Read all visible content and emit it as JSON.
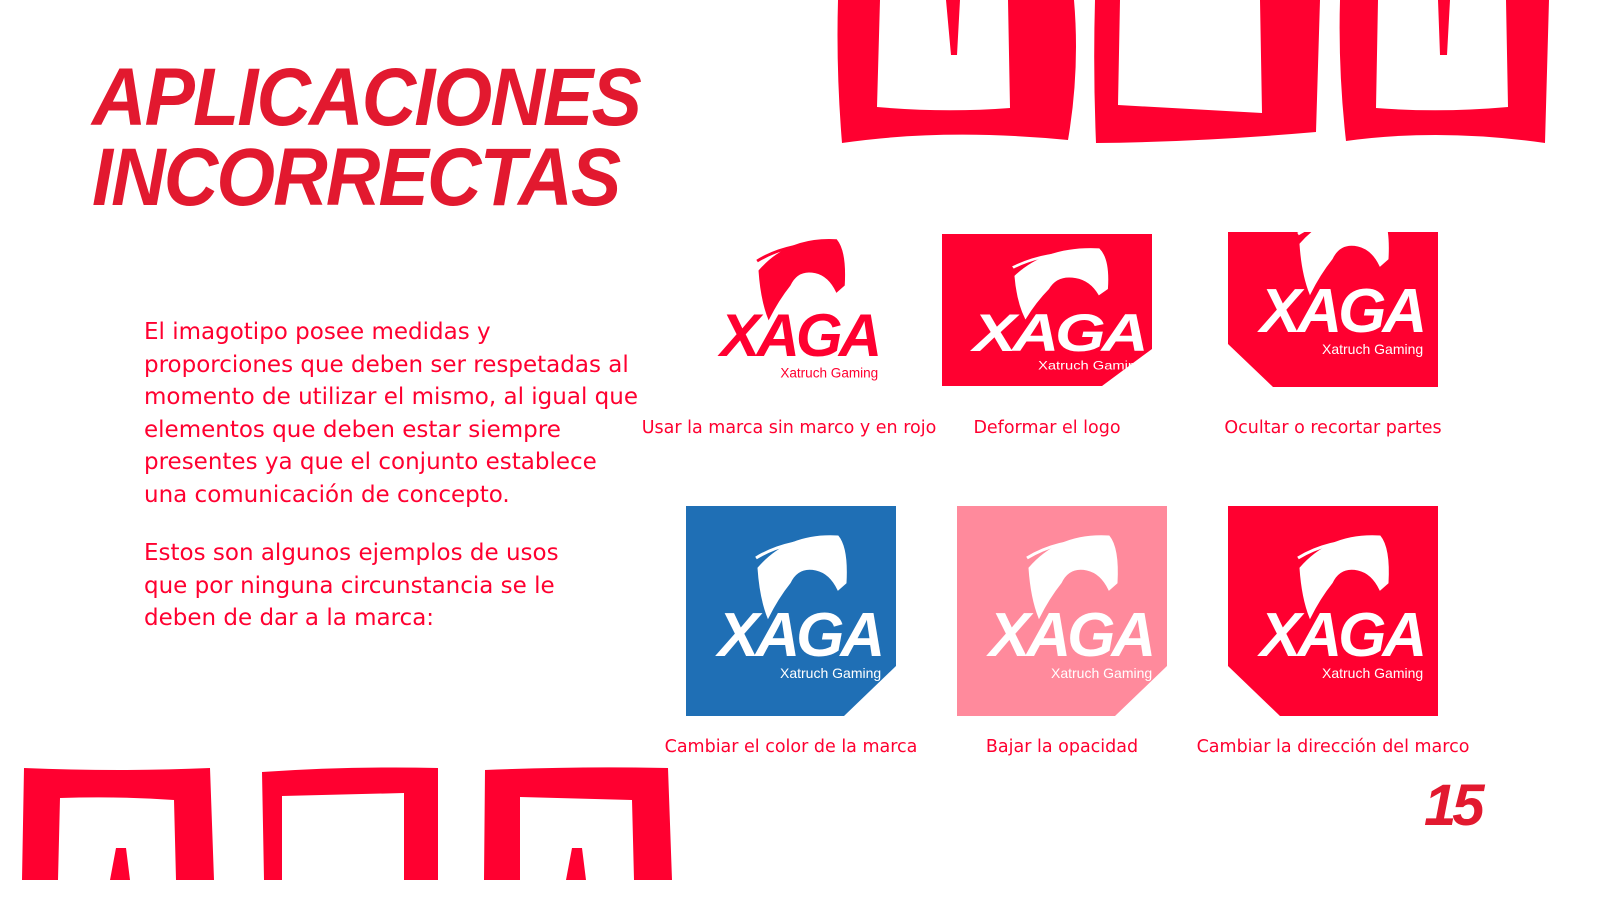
{
  "title": {
    "line1": "APLICACIONES",
    "line2": "INCORRECTAS"
  },
  "paragraphs": [
    "El imagotipo posee medidas y proporciones que deben ser respetadas al momento de utilizar el mismo, al igual que elementos que deben estar siempre presentes ya que el conjunto establece una comunicación de concepto.",
    "Estos son algunos ejemplos de usos que por ninguna circunstancia se le deben de dar a la marca:"
  ],
  "logo": {
    "wordmark": "XAGA",
    "tagline": "Xatruch Gaming"
  },
  "examples": [
    {
      "caption": "Usar la marca sin marco y en rojo",
      "background": "none"
    },
    {
      "caption": "Deformar el logo",
      "background": "#ff0030"
    },
    {
      "caption": "Ocultar o recortar partes",
      "background": "#ff0030"
    },
    {
      "caption": "Cambiar el color de la marca",
      "background": "#1f6fb5"
    },
    {
      "caption": "Bajar la opacidad",
      "background": "#ff8a9c"
    },
    {
      "caption": "Cambiar la dirección del marco",
      "background": "#ff0030"
    }
  ],
  "page_number": "15",
  "colors": {
    "brand_red": "#ff0030",
    "blue": "#1f6fb5",
    "pink": "#ff8a9c"
  }
}
